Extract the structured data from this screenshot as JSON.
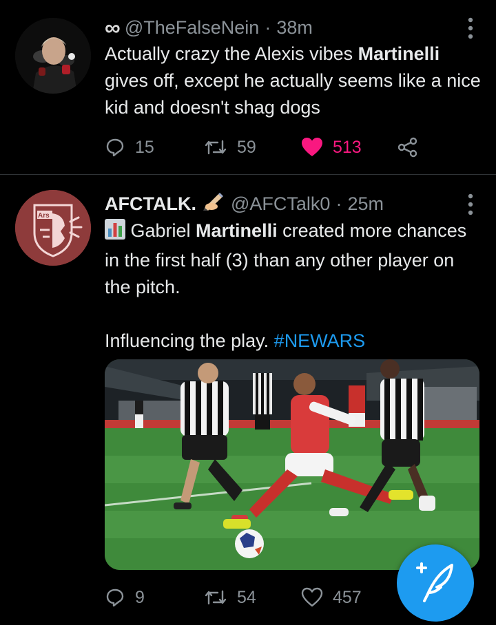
{
  "tweets": [
    {
      "badge_icon": "infinity-icon",
      "handle": "@TheFalseNein",
      "separator": "·",
      "time": "38m",
      "text_before": "Actually crazy the Alexis vibes ",
      "text_bold": "Martinelli",
      "text_after": " gives off, except he actually seems like a nice kid and doesn't shag dogs",
      "replies": "15",
      "retweets": "59",
      "likes": "513",
      "liked": true
    },
    {
      "name": "AFCTALK.",
      "badge_icon": "writing-hand-icon",
      "handle": "@AFCTalk0",
      "separator": "·",
      "time": "25m",
      "line1_before": " Gabriel ",
      "line1_bold": "Martinelli",
      "line1_after": " created more chances in the first half (3) than any other player on the pitch.",
      "line2_text": "Influencing the play. ",
      "hashtag": "#NEWARS",
      "media_icon": "football-photo",
      "replies": "9",
      "retweets": "54",
      "likes": "457",
      "liked": false
    }
  ],
  "colors": {
    "background": "#000000",
    "text": "#e7e9ea",
    "muted": "#8b9298",
    "accent": "#1d9bf0",
    "like": "#f91880"
  },
  "compose_button_icon": "compose-feather-icon"
}
